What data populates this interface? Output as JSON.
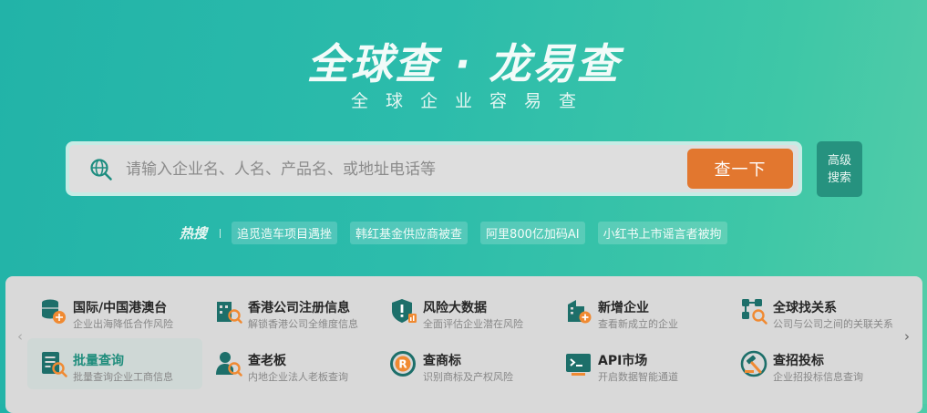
{
  "brand": {
    "title": "全球查 · 龙易查",
    "subtitle": "全球企业容易查"
  },
  "search": {
    "placeholder": "请输入企业名、人名、产品名、或地址电话等",
    "value": "",
    "button_label": "查一下",
    "advanced_label_line1": "高级",
    "advanced_label_line2": "搜索"
  },
  "hot": {
    "label": "热搜",
    "tags": [
      "追觅造车项目遇挫",
      "韩红基金供应商被查",
      "阿里800亿加码AI",
      "小红书上市谣言者被拘"
    ]
  },
  "services": {
    "items": [
      {
        "title": "国际/中国港澳台",
        "desc": "企业出海降低合作风险",
        "icon": "globe-database-icon"
      },
      {
        "title": "香港公司注册信息",
        "desc": "解锁香港公司全维度信息",
        "icon": "building-search-icon"
      },
      {
        "title": "风险大数据",
        "desc": "全面评估企业潜在风险",
        "icon": "shield-alert-icon"
      },
      {
        "title": "新增企业",
        "desc": "查看新成立的企业",
        "icon": "building-plus-icon"
      },
      {
        "title": "全球找关系",
        "desc": "公司与公司之间的关联关系",
        "icon": "network-search-icon"
      },
      {
        "title": "批量查询",
        "desc": "批量查询企业工商信息",
        "icon": "list-search-icon"
      },
      {
        "title": "查老板",
        "desc": "内地企业法人老板查询",
        "icon": "person-search-icon"
      },
      {
        "title": "查商标",
        "desc": "识别商标及产权风险",
        "icon": "trademark-icon"
      },
      {
        "title": "API市场",
        "desc": "开启数据智能通道",
        "icon": "api-terminal-icon"
      },
      {
        "title": "查招投标",
        "desc": "企业招投标信息查询",
        "icon": "gavel-icon"
      }
    ]
  },
  "colors": {
    "accent_orange": "#e2772f",
    "brand_teal": "#2cbcab",
    "icon_dark": "#1d6f6a",
    "icon_orange": "#f08a32"
  }
}
